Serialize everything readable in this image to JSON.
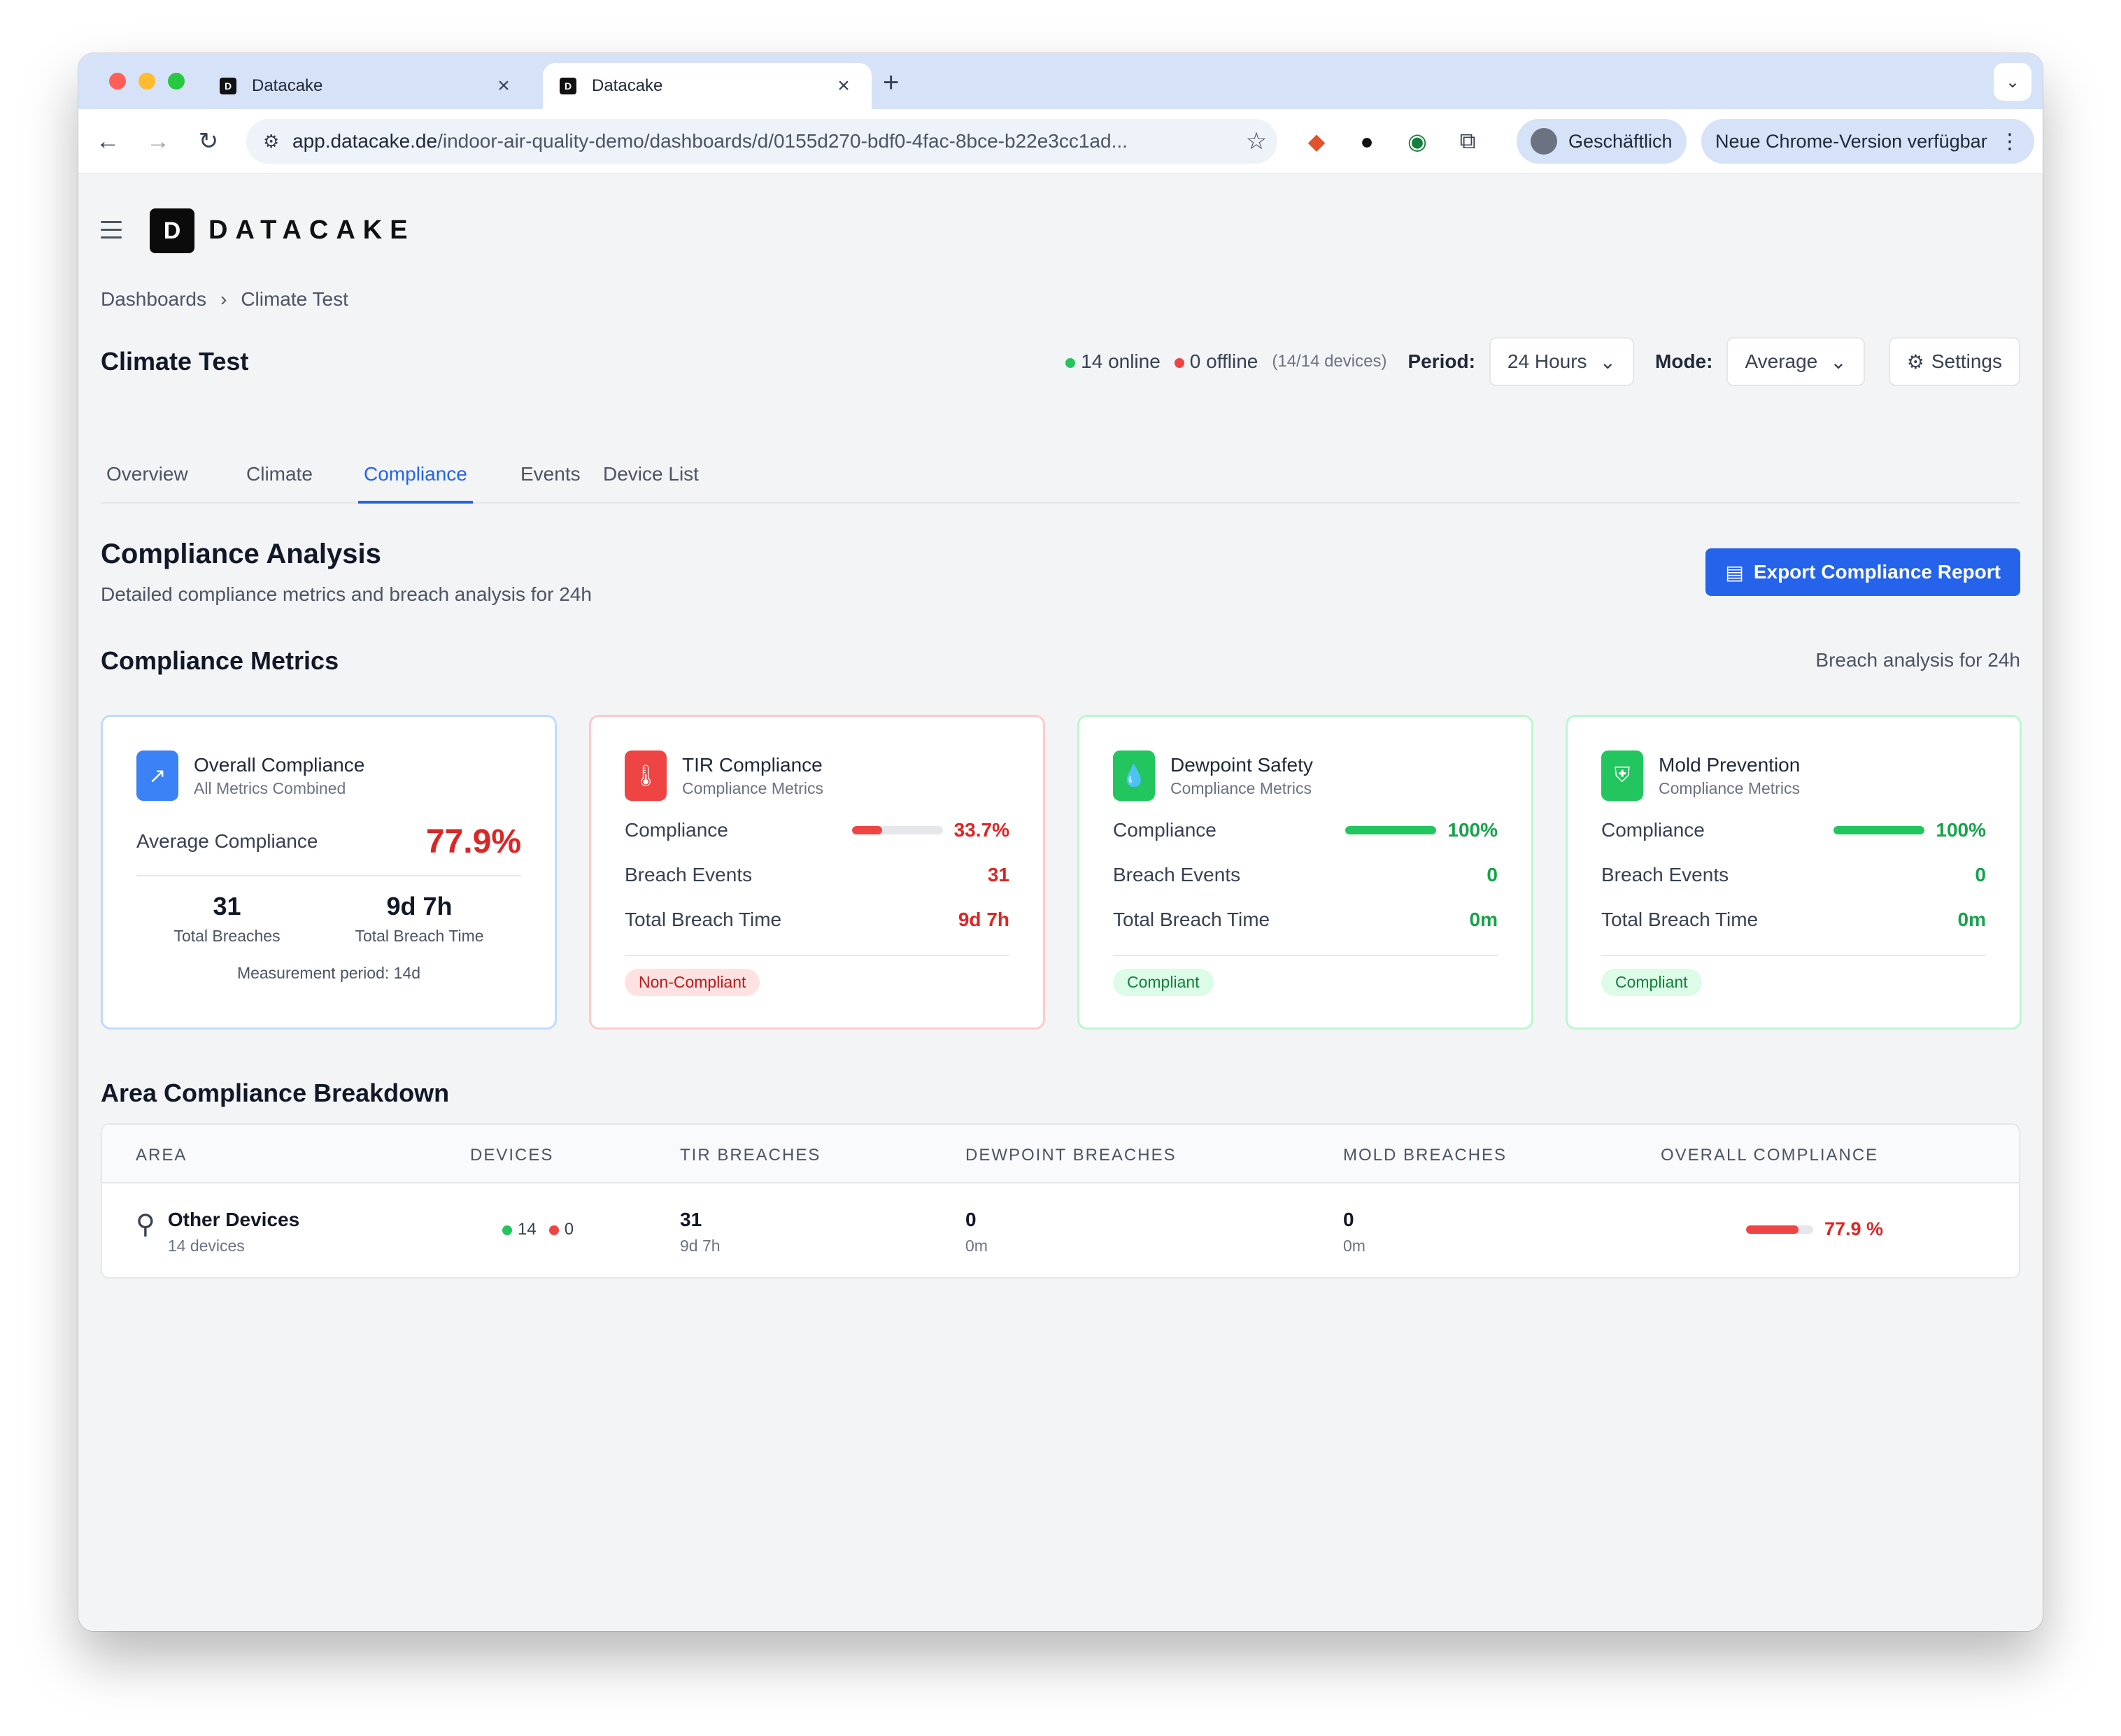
{
  "browser": {
    "tabs": [
      {
        "title": "Datacake",
        "active": false
      },
      {
        "title": "Datacake",
        "active": true
      }
    ],
    "url_host": "app.datacake.de",
    "url_path": "/indoor-air-quality-demo/dashboards/d/0155d270-bdf0-4fac-8bce-b22e3cc1ad...",
    "profile_label": "Geschäftlich",
    "update_label": "Neue Chrome-Version verfügbar"
  },
  "app": {
    "logo_text": "DATACAKE",
    "breadcrumb": [
      "Dashboards",
      "Climate Test"
    ],
    "page_title": "Climate Test",
    "status": {
      "online": "14 online",
      "offline": "0 offline",
      "devices": "(14/14 devices)"
    },
    "period_label": "Period:",
    "period_value": "24 Hours",
    "mode_label": "Mode:",
    "mode_value": "Average",
    "settings_label": "Settings",
    "tabs": [
      "Overview",
      "Climate",
      "Compliance",
      "Events",
      "Device List"
    ],
    "active_tab": "Compliance",
    "analysis_title": "Compliance Analysis",
    "analysis_sub": "Detailed compliance metrics and breach analysis for 24h",
    "export_label": "Export Compliance Report",
    "metrics_title": "Compliance Metrics",
    "metrics_note": "Breach analysis for 24h",
    "overall": {
      "title": "Overall Compliance",
      "subtitle": "All Metrics Combined",
      "avg_label": "Average Compliance",
      "avg_value": "77.9%",
      "breaches_value": "31",
      "breaches_label": "Total Breaches",
      "time_value": "9d 7h",
      "time_label": "Total Breach Time",
      "period_note": "Measurement period: 14d"
    },
    "cards": [
      {
        "title": "TIR Compliance",
        "subtitle": "Compliance Metrics",
        "compliance_label": "Compliance",
        "compliance_value": "33.7%",
        "compliance_fraction": 0.337,
        "breach_label": "Breach Events",
        "breach_value": "31",
        "time_label": "Total Breach Time",
        "time_value": "9d 7h",
        "badge": "Non-Compliant",
        "status_color": "#dc2626"
      },
      {
        "title": "Dewpoint Safety",
        "subtitle": "Compliance Metrics",
        "compliance_label": "Compliance",
        "compliance_value": "100%",
        "compliance_fraction": 1.0,
        "breach_label": "Breach Events",
        "breach_value": "0",
        "time_label": "Total Breach Time",
        "time_value": "0m",
        "badge": "Compliant",
        "status_color": "#16a34a"
      },
      {
        "title": "Mold Prevention",
        "subtitle": "Compliance Metrics",
        "compliance_label": "Compliance",
        "compliance_value": "100%",
        "compliance_fraction": 1.0,
        "breach_label": "Breach Events",
        "breach_value": "0",
        "time_label": "Total Breach Time",
        "time_value": "0m",
        "badge": "Compliant",
        "status_color": "#16a34a"
      }
    ],
    "breakdown_title": "Area Compliance Breakdown",
    "table": {
      "headers": [
        "AREA",
        "DEVICES",
        "TIR BREACHES",
        "DEWPOINT BREACHES",
        "MOLD BREACHES",
        "OVERALL COMPLIANCE"
      ],
      "rows": [
        {
          "area": "Other Devices",
          "area_sub": "14 devices",
          "online": "14",
          "offline": "0",
          "tir": "31",
          "tir_sub": "9d 7h",
          "dew": "0",
          "dew_sub": "0m",
          "mold": "0",
          "mold_sub": "0m",
          "overall": "77.9 %",
          "overall_fraction": 0.779
        }
      ]
    }
  }
}
